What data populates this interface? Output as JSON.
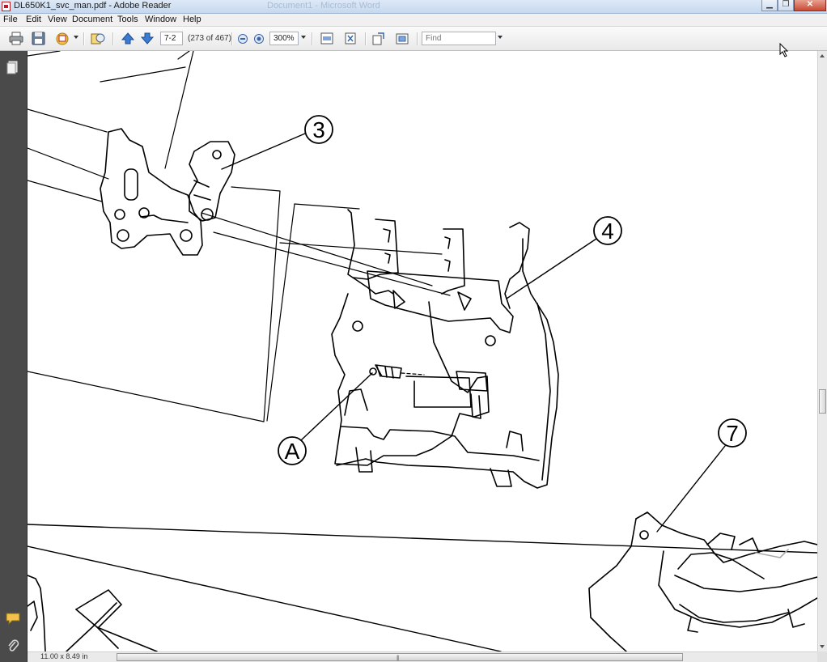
{
  "window": {
    "title": "DL650K1_svc_man.pdf - Adobe Reader",
    "ghost_title": "Document1 - Microsoft Word"
  },
  "menu": [
    "File",
    "Edit",
    "View",
    "Document",
    "Tools",
    "Window",
    "Help"
  ],
  "toolbar": {
    "page_input": "7-2",
    "page_count": "(273 of 467)",
    "zoom": "300%",
    "find_placeholder": "Find"
  },
  "status": {
    "page_size": "11.00 x 8.49 in"
  },
  "diagram": {
    "callouts": [
      "3",
      "4",
      "7",
      "A"
    ]
  },
  "colors": {
    "titlebar": "#c7d8ee",
    "nav_panel": "#4a4a4a",
    "close_button": "#c74a35"
  },
  "icons": [
    "print-icon",
    "save-icon",
    "email-icon",
    "organizer-icon",
    "previous-page-icon",
    "next-page-icon",
    "zoom-out-icon",
    "zoom-in-icon",
    "fit-page-icon",
    "full-screen-icon",
    "rotate-icon",
    "pages-panel-icon",
    "comments-icon",
    "attachments-icon"
  ]
}
